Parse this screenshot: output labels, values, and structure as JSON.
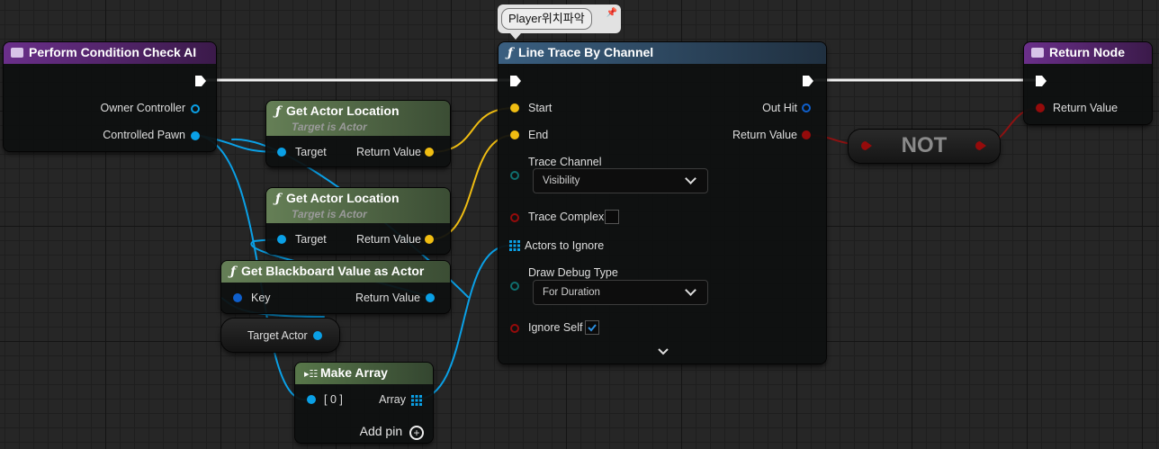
{
  "comment": {
    "text": "Player위치파악"
  },
  "nodes": {
    "perform": {
      "title": "Perform Condition Check AI",
      "pins": {
        "owner": "Owner Controller",
        "pawn": "Controlled Pawn"
      }
    },
    "linetrace": {
      "title": "Line Trace By Channel",
      "pins": {
        "start": "Start",
        "end": "End",
        "trace_channel": "Trace Channel",
        "trace_complex": "Trace Complex",
        "actors_to_ignore": "Actors to Ignore",
        "draw_debug": "Draw Debug Type",
        "ignore_self": "Ignore Self",
        "out_hit": "Out Hit",
        "return_value": "Return Value"
      },
      "trace_channel_value": "Visibility",
      "draw_debug_value": "For Duration",
      "trace_complex_checked": false,
      "ignore_self_checked": true
    },
    "return": {
      "title": "Return Node",
      "pins": {
        "return_value": "Return Value"
      }
    },
    "get_loc1": {
      "title": "Get Actor Location",
      "subtitle": "Target is Actor",
      "pins": {
        "target": "Target",
        "return_value": "Return Value"
      }
    },
    "get_loc2": {
      "title": "Get Actor Location",
      "subtitle": "Target is Actor",
      "pins": {
        "target": "Target",
        "return_value": "Return Value"
      }
    },
    "blackboard": {
      "title": "Get Blackboard Value as Actor",
      "pins": {
        "key": "Key",
        "return_value": "Return Value"
      }
    },
    "target_actor": {
      "label": "Target Actor"
    },
    "not": {
      "label": "NOT"
    },
    "make_array": {
      "title": "Make Array",
      "pins": {
        "index0": "[ 0 ]",
        "array": "Array",
        "add_pin": "Add pin"
      }
    }
  },
  "colors": {
    "exec": "#ffffff",
    "object": "#0ea5f0",
    "vector": "#f5c214",
    "bool": "#950b0b",
    "struct": "#0f5fcc",
    "enum": "#0f6e6e",
    "func_header": "#2c4a66",
    "pure_header": "#566f4a",
    "event_header": "#5a2c72",
    "make_array_header": "#4b6740"
  }
}
